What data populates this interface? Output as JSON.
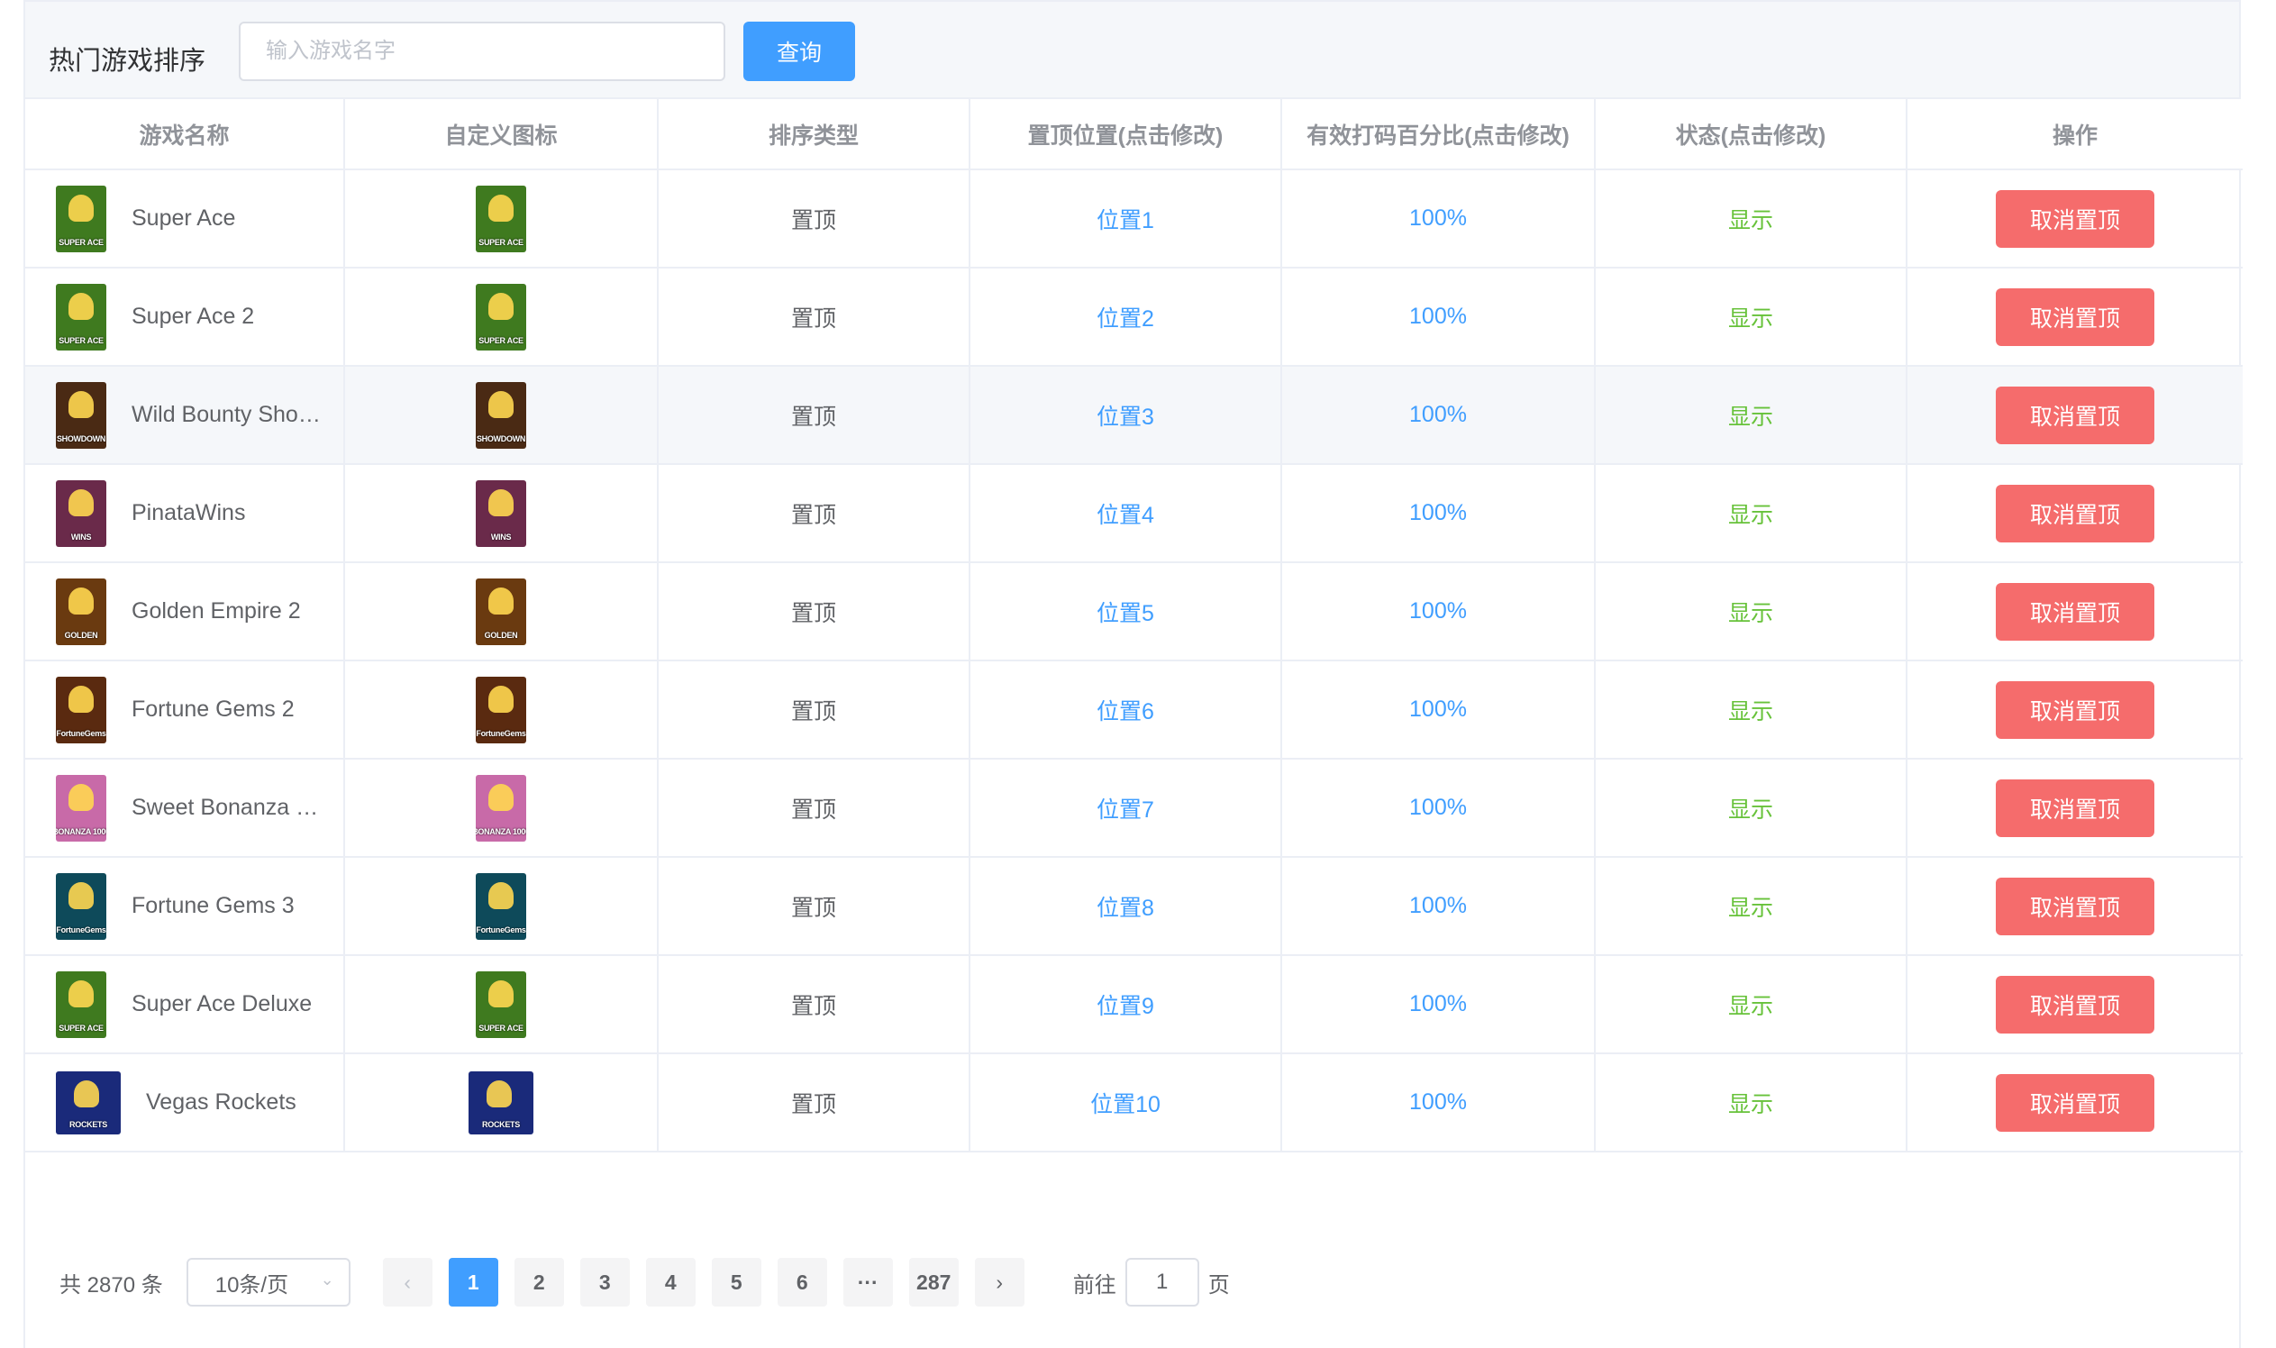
{
  "toolbar": {
    "title": "热门游戏排序",
    "search_placeholder": "输入游戏名字",
    "search_value": "",
    "query_label": "查询"
  },
  "table": {
    "columns": [
      "游戏名称",
      "自定义图标",
      "排序类型",
      "置顶位置(点击修改)",
      "有效打码百分比(点击修改)",
      "状态(点击修改)",
      "操作"
    ],
    "rows": [
      {
        "name": "Super Ace",
        "thumb": "SUPER ACE",
        "type": "置顶",
        "position": "位置1",
        "percent": "100%",
        "status": "显示",
        "action": "取消置顶"
      },
      {
        "name": "Super Ace 2",
        "thumb": "SUPER ACE",
        "type": "置顶",
        "position": "位置2",
        "percent": "100%",
        "status": "显示",
        "action": "取消置顶"
      },
      {
        "name": "Wild Bounty Sho…",
        "thumb": "SHOWDOWN",
        "type": "置顶",
        "position": "位置3",
        "percent": "100%",
        "status": "显示",
        "action": "取消置顶"
      },
      {
        "name": "PinataWins",
        "thumb": "WINS",
        "type": "置顶",
        "position": "位置4",
        "percent": "100%",
        "status": "显示",
        "action": "取消置顶"
      },
      {
        "name": "Golden Empire 2",
        "thumb": "GOLDEN",
        "type": "置顶",
        "position": "位置5",
        "percent": "100%",
        "status": "显示",
        "action": "取消置顶"
      },
      {
        "name": "Fortune Gems 2",
        "thumb": "FortuneGems",
        "type": "置顶",
        "position": "位置6",
        "percent": "100%",
        "status": "显示",
        "action": "取消置顶"
      },
      {
        "name": "Sweet Bonanza …",
        "thumb": "BONANZA 1000",
        "type": "置顶",
        "position": "位置7",
        "percent": "100%",
        "status": "显示",
        "action": "取消置顶"
      },
      {
        "name": "Fortune Gems 3",
        "thumb": "FortuneGems",
        "type": "置顶",
        "position": "位置8",
        "percent": "100%",
        "status": "显示",
        "action": "取消置顶"
      },
      {
        "name": "Super Ace Deluxe",
        "thumb": "SUPER ACE",
        "type": "置顶",
        "position": "位置9",
        "percent": "100%",
        "status": "显示",
        "action": "取消置顶"
      },
      {
        "name": "Vegas Rockets",
        "thumb": "ROCKETS",
        "type": "置顶",
        "position": "位置10",
        "percent": "100%",
        "status": "显示",
        "action": "取消置顶"
      }
    ]
  },
  "thumb_colors": [
    "#3f7a1f",
    "#3f7a1f",
    "#4a2a14",
    "#6a2a4a",
    "#6a3a10",
    "#5a2a10",
    "#c86aa8",
    "#0e4a5a",
    "#3f7a1f",
    "#1a2a7a"
  ],
  "hover_row_index": 2,
  "pagination": {
    "total": "共 2870 条",
    "page_size": "10条/页",
    "pages": [
      "1",
      "2",
      "3",
      "4",
      "5",
      "6",
      "···",
      "287"
    ],
    "current": "1",
    "goto_label": "前往",
    "goto_value": "1",
    "page_suffix": "页",
    "prev_icon": "chevron-left-icon",
    "next_icon": "chevron-right-icon"
  },
  "colors": {
    "primary": "#409eff",
    "danger": "#f56c6c",
    "success": "#67c23a"
  }
}
